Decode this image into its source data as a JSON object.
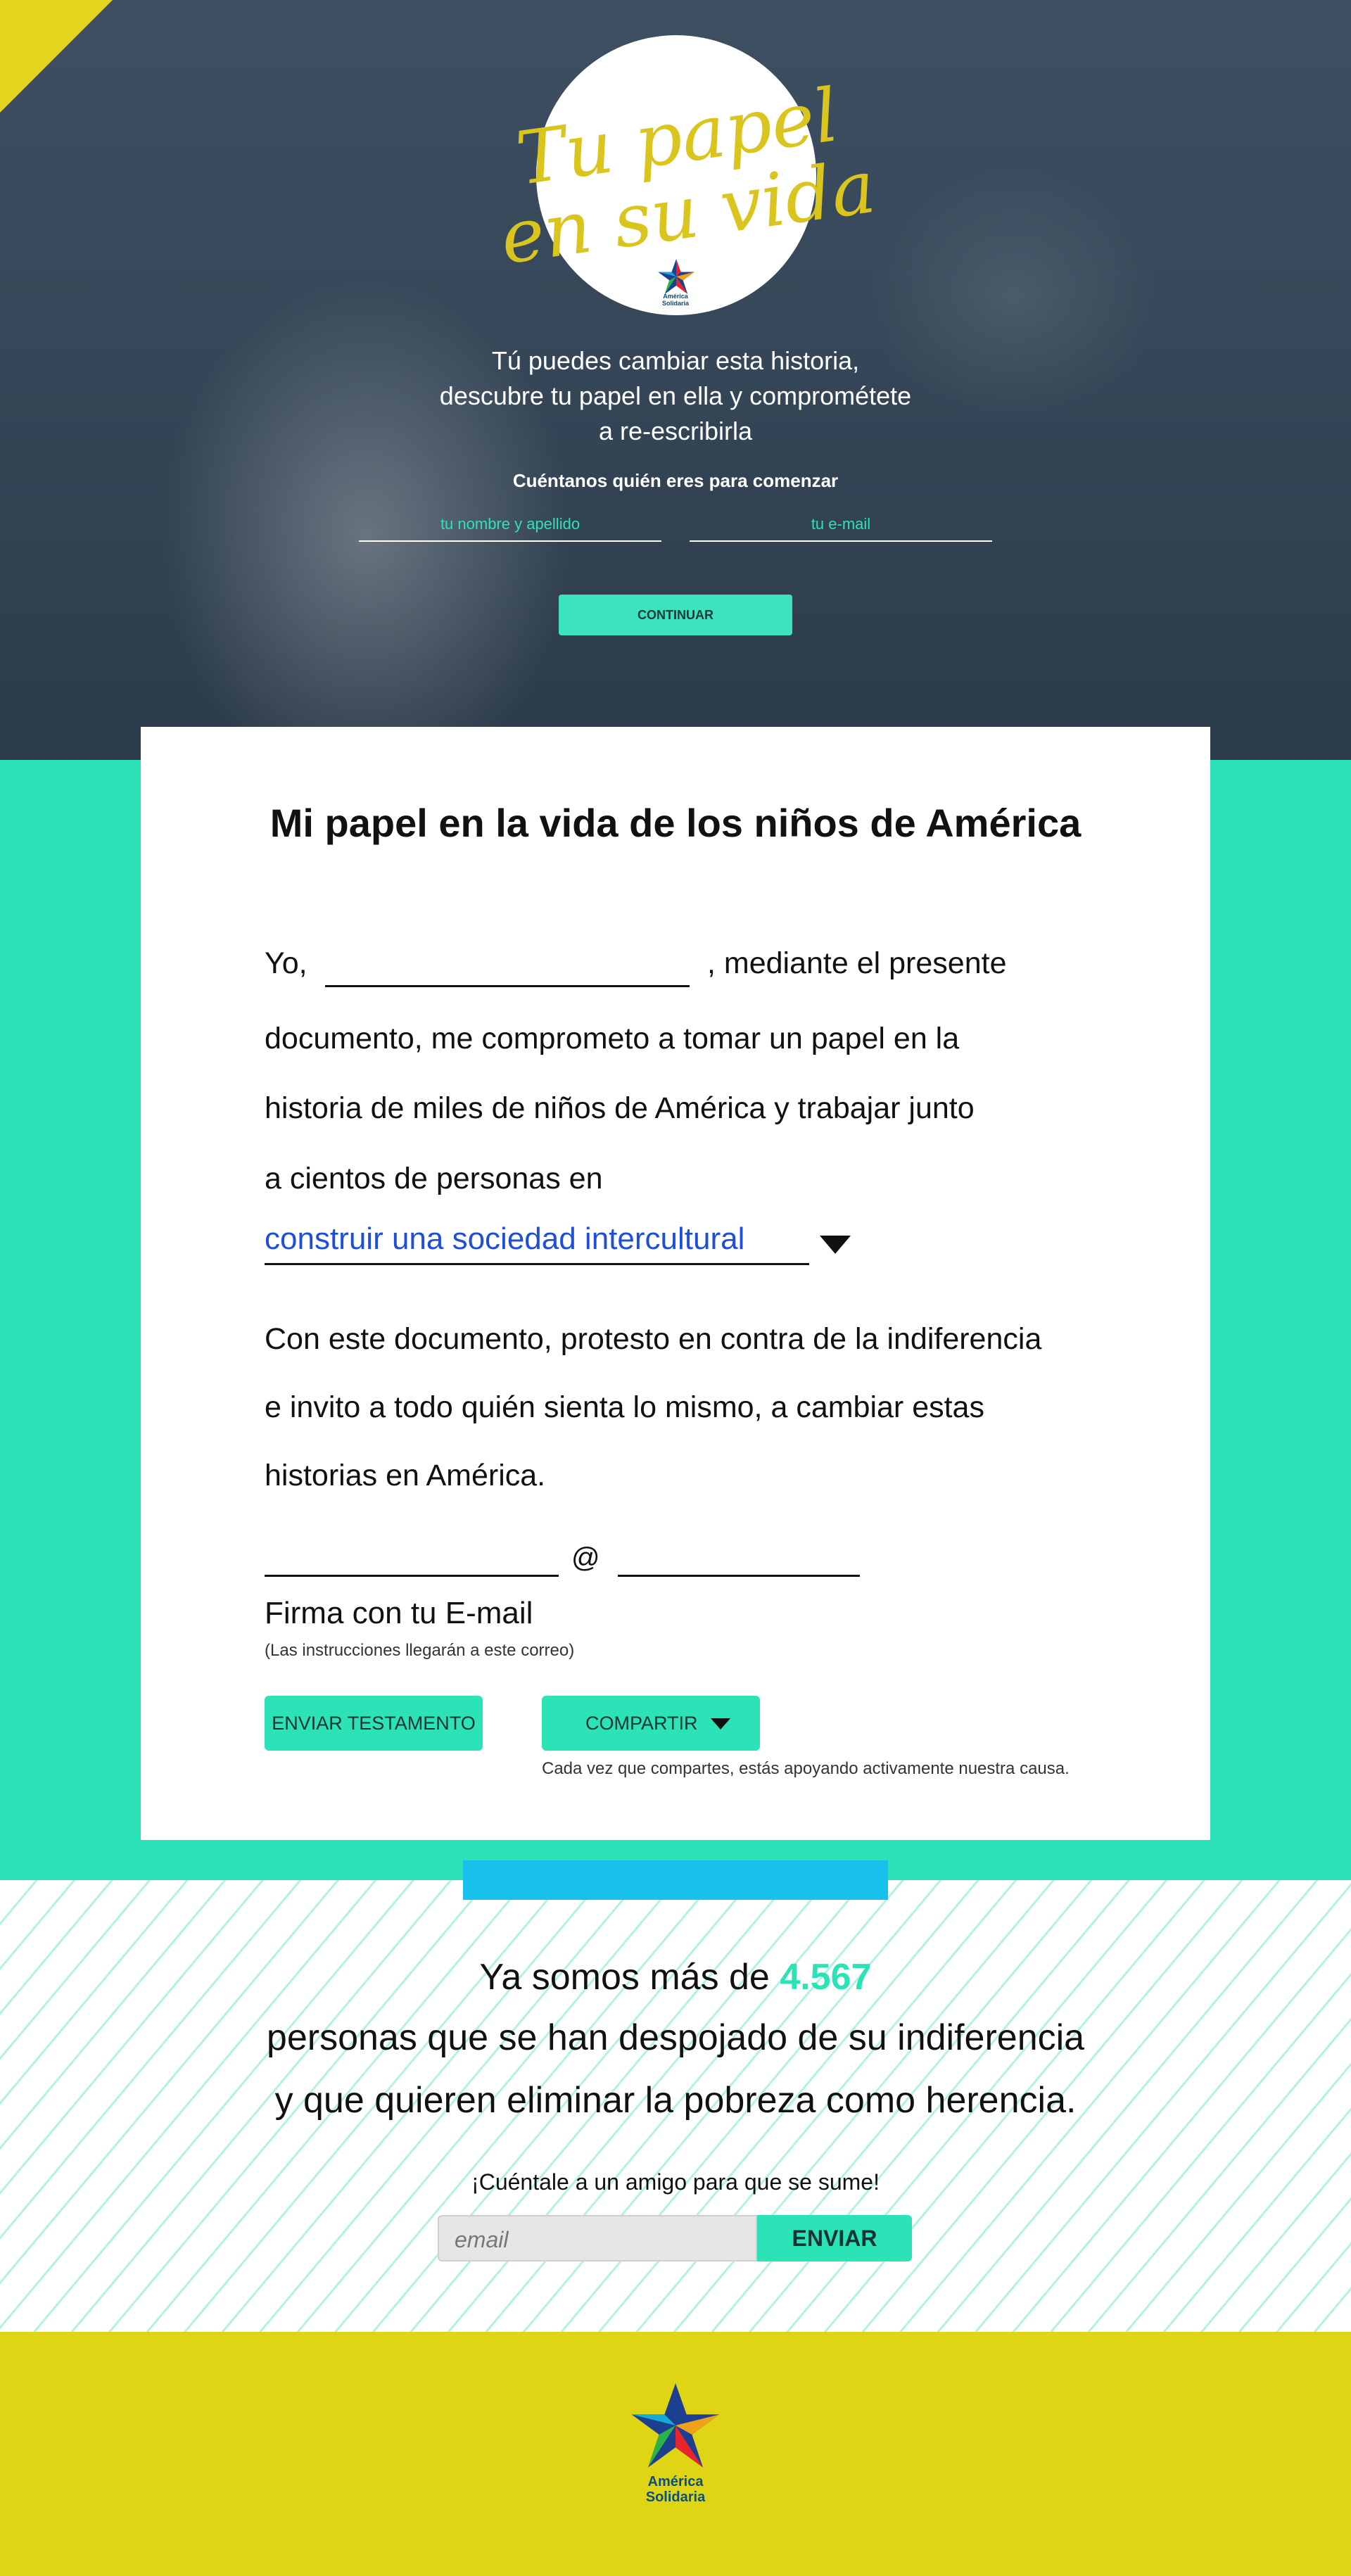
{
  "hero": {
    "logo_line1": "Tu papel",
    "logo_line2": "en su vida",
    "brand_small_1": "América",
    "brand_small_2": "Solidaria",
    "tagline_1": "Tú puedes cambiar esta historia,",
    "tagline_2": "descubre tu papel en ella y comprométete",
    "tagline_3": "a re-escribirla",
    "prompt": "Cuéntanos quién eres para comenzar",
    "name_placeholder": "tu nombre y apellido",
    "email_placeholder": "tu e-mail",
    "continue_label": "CONTINUAR"
  },
  "card": {
    "title": "Mi papel en la vida de los niños de América",
    "pledge_yo": "Yo,",
    "pledge_1_rest": ", mediante el presente",
    "pledge_2": "documento, me comprometo a tomar un papel en la",
    "pledge_3": "historia de miles de niños de América y trabajar junto",
    "pledge_4": "a cientos de personas en",
    "cause_selected": "construir una sociedad intercultural",
    "protest_1": "Con este documento, protesto en contra de la indiferencia",
    "protest_2": "e invito a todo quién sienta lo mismo, a cambiar estas",
    "protest_3": "historias en América.",
    "at_sign": "@",
    "signature_label": "Firma con tu E-mail",
    "signature_note": "(Las instrucciones llegarán a este correo)",
    "send_label": "ENVIAR TESTAMENTO",
    "share_label": "COMPARTIR",
    "share_note": "Cada vez que compartes, estás apoyando activamente nuestra causa."
  },
  "counter": {
    "line1_prefix": "Ya somos más de",
    "count": "4.567",
    "line2": "personas que se han despojado de su indiferencia",
    "line3": "y que quieren eliminar la pobreza como herencia.",
    "tell_friend": "¡Cuéntale a un amigo para que se sume!",
    "email_placeholder": "email",
    "send_label": "ENVIAR"
  },
  "footer": {
    "brand_1": "América",
    "brand_2": "Solidaria"
  },
  "colors": {
    "mint": "#2be3b7",
    "yellow": "#dfd515",
    "blue_bar": "#17c1ec",
    "cause_blue": "#1f4fd6"
  }
}
